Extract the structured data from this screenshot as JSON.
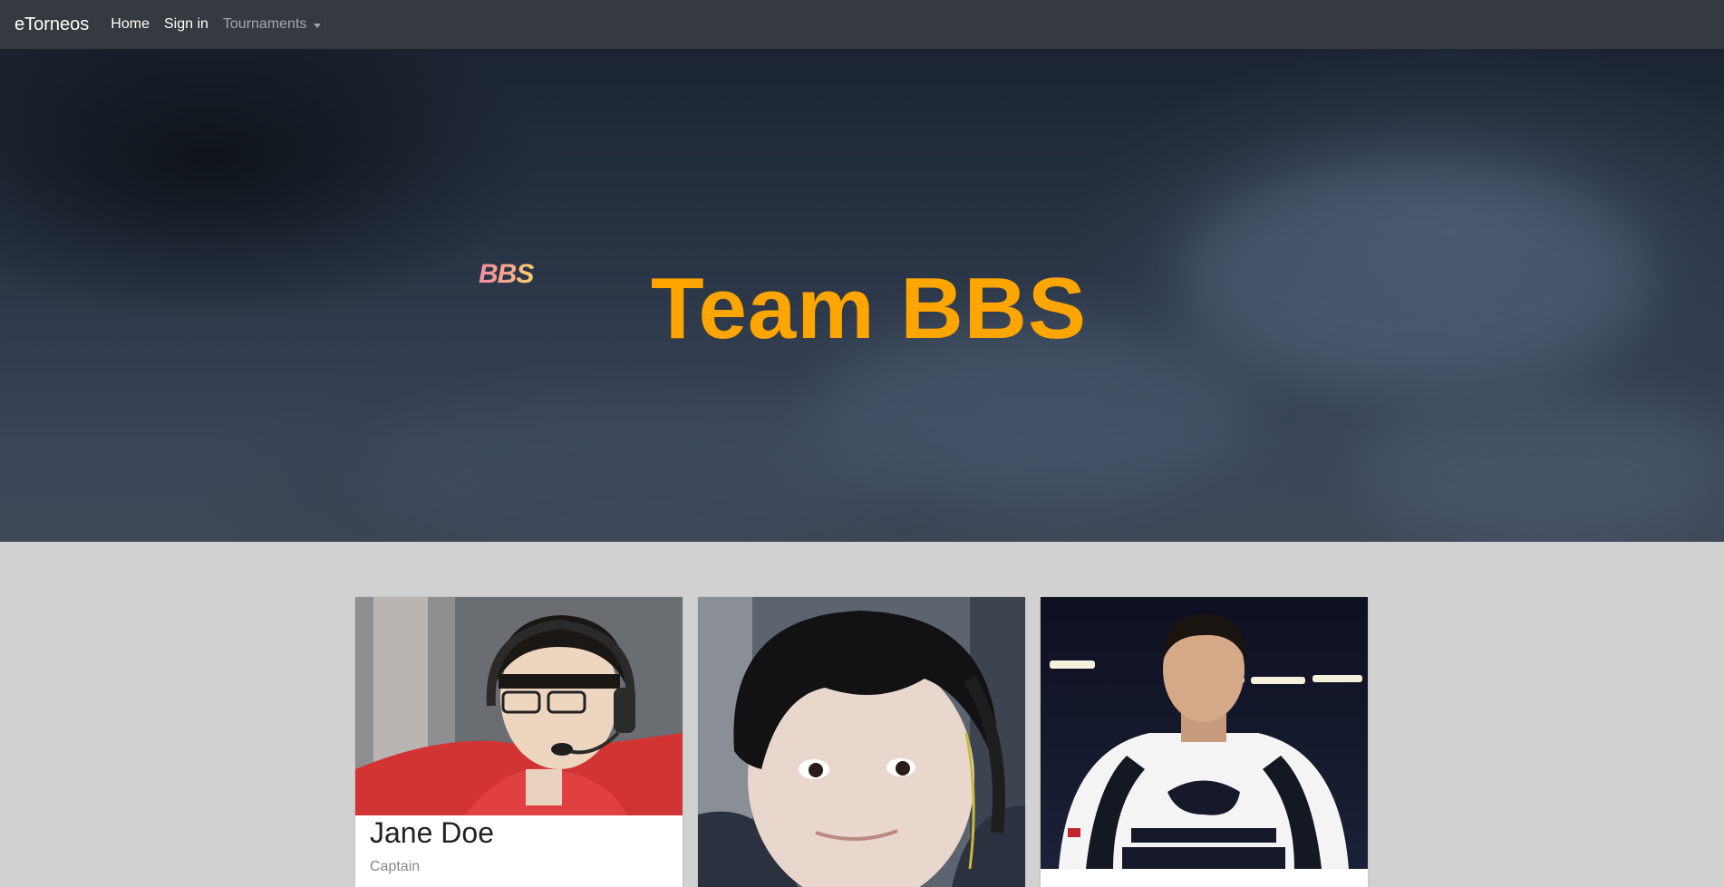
{
  "navbar": {
    "brand": "eTorneos",
    "links": [
      {
        "label": "Home"
      },
      {
        "label": "Sign in"
      }
    ],
    "dropdown_label": "Tournaments"
  },
  "hero": {
    "logo_text": "BBS",
    "title": "Team BBS",
    "title_color": "#ffa500"
  },
  "members": [
    {
      "name": "Jane Doe",
      "role": "Captain"
    },
    {
      "name": "",
      "role": ""
    },
    {
      "name": "",
      "role": ""
    }
  ],
  "colors": {
    "navbar_bg": "#343a40",
    "page_bg": "#d1d1d1",
    "accent": "#ffa500"
  }
}
